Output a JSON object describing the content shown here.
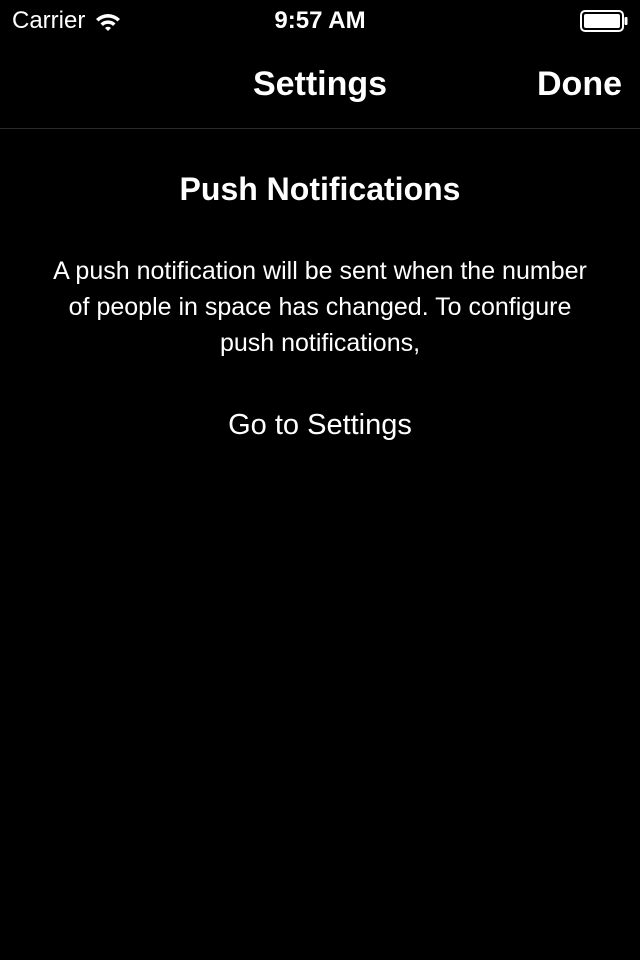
{
  "status_bar": {
    "carrier": "Carrier",
    "time": "9:57 AM",
    "wifi_icon": "wifi-icon",
    "battery_icon": "battery-icon",
    "battery_level": 1.0
  },
  "nav": {
    "title": "Settings",
    "done_label": "Done"
  },
  "main": {
    "section_title": "Push Notifications",
    "description": "A push notification will be sent when the number of people in space has changed. To configure push notifications,",
    "settings_link": "Go to Settings"
  },
  "colors": {
    "background": "#000000",
    "text": "#ffffff",
    "separator": "#2b2b2b"
  }
}
